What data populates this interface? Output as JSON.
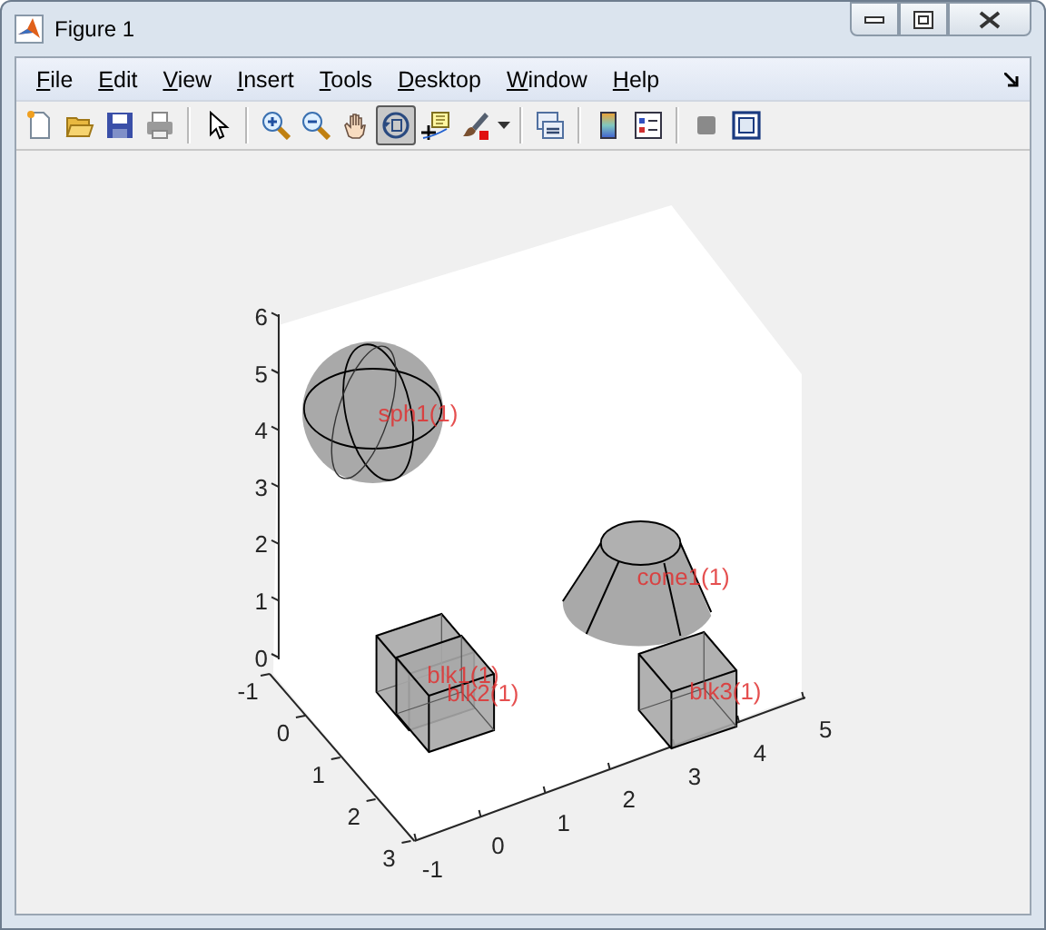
{
  "window": {
    "title": "Figure 1"
  },
  "menu": [
    "File",
    "Edit",
    "View",
    "Insert",
    "Tools",
    "Desktop",
    "Window",
    "Help"
  ],
  "toolbar": [
    {
      "selected": false
    },
    {
      "selected": false
    },
    {
      "selected": false
    },
    {
      "selected": false
    },
    {
      "selected": false
    },
    {
      "selected": false
    },
    {
      "selected": false
    },
    {
      "selected": false
    },
    {
      "selected": true
    },
    {
      "selected": false
    },
    {
      "selected": false
    },
    {
      "selected": false
    },
    {
      "selected": false
    },
    {
      "selected": false
    },
    {
      "selected": false
    },
    {
      "selected": false
    },
    {
      "selected": false
    }
  ],
  "axes": {
    "x_ticks": [
      "-1",
      "0",
      "1",
      "2",
      "3",
      "4",
      "5"
    ],
    "y_ticks": [
      "-1",
      "0",
      "1",
      "2",
      "3"
    ],
    "z_ticks": [
      "6",
      "5",
      "4",
      "3",
      "2",
      "1",
      "0"
    ]
  },
  "objects": [
    {
      "kind": "sphere",
      "label": "sph1(1)"
    },
    {
      "kind": "cone",
      "label": "cone1(1)"
    },
    {
      "kind": "block",
      "label": "blk1(1)"
    },
    {
      "kind": "block",
      "label": "blk2(1)"
    },
    {
      "kind": "block",
      "label": "blk3(1)"
    }
  ]
}
